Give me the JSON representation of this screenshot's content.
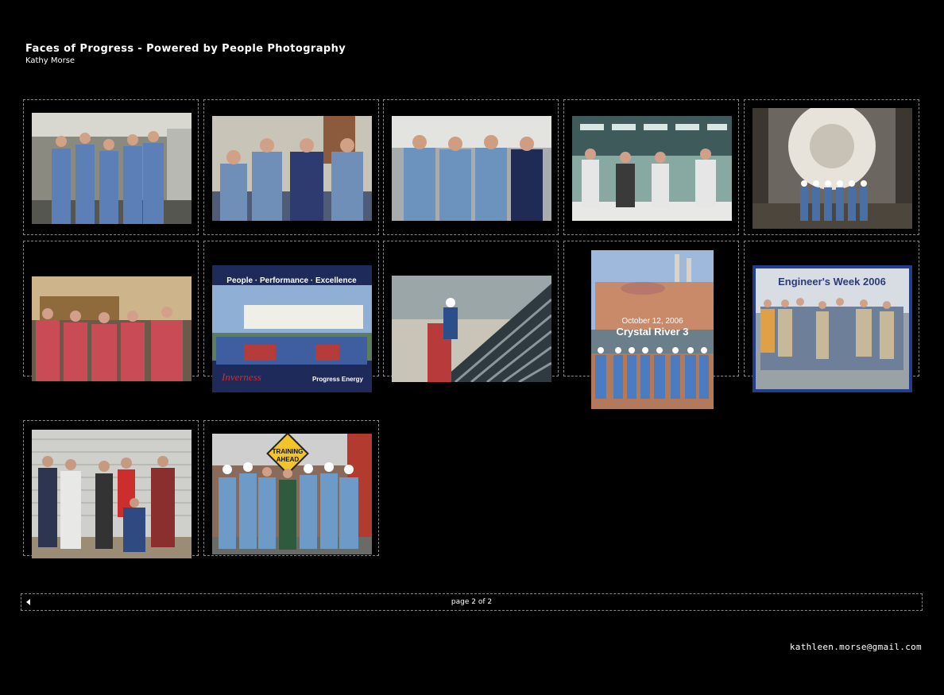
{
  "header": {
    "title": "Faces of Progress - Powered by People Photography",
    "subtitle": "Kathy Morse"
  },
  "gallery": {
    "thumbnails": [
      {
        "id": 1
      },
      {
        "id": 2
      },
      {
        "id": 3
      },
      {
        "id": 4
      },
      {
        "id": 5
      },
      {
        "id": 6
      },
      {
        "id": 7,
        "caption_top": "People · Performance · Excellence",
        "caption_left": "Inverness",
        "caption_right": "Progress Energy"
      },
      {
        "id": 8
      },
      {
        "id": 9,
        "caption_date": "October 12, 2006",
        "caption_main": "Crystal River 3"
      },
      {
        "id": 10,
        "caption_top": "Engineer's Week 2006"
      },
      {
        "id": 11
      },
      {
        "id": 12,
        "sign_line1": "TRAINING",
        "sign_line2": "AHEAD"
      }
    ]
  },
  "pager": {
    "prev_icon": "triangle-left",
    "label": "page 2 of 2"
  },
  "footer": {
    "email": "kathleen.morse@gmail.com"
  }
}
